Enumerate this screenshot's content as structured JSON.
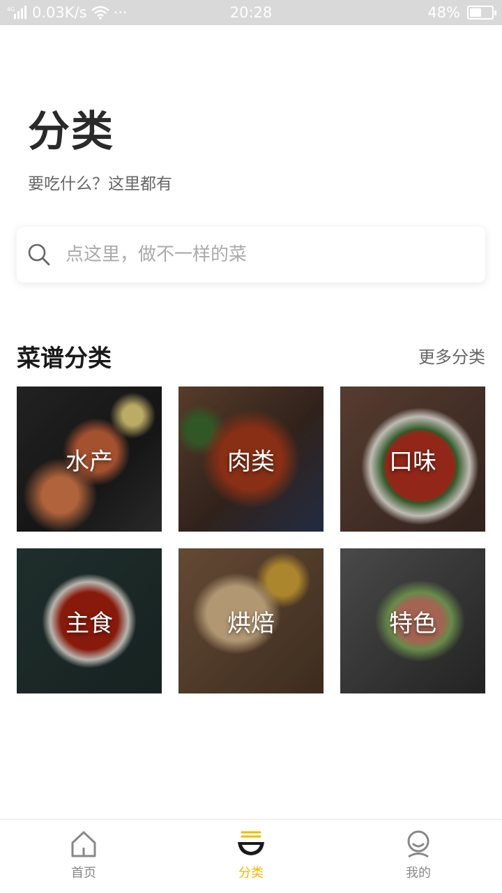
{
  "status_bar": {
    "network_type": "4G",
    "speed": "0.03K/s",
    "more": "···",
    "time": "20:28",
    "battery_percent_text": "48%",
    "battery_level": 0.48,
    "icons": [
      "signal-icon",
      "wifi-icon",
      "battery-icon"
    ]
  },
  "header": {
    "title": "分类",
    "subtitle": "要吃什么？这里都有"
  },
  "search": {
    "placeholder": "点这里，做不一样的菜",
    "icon": "search-icon"
  },
  "section": {
    "title": "菜谱分类",
    "more_label": "更多分类"
  },
  "categories": [
    {
      "label": "水产"
    },
    {
      "label": "肉类"
    },
    {
      "label": "口味"
    },
    {
      "label": "主食"
    },
    {
      "label": "烘焙"
    },
    {
      "label": "特色"
    }
  ],
  "bottom_nav": {
    "items": [
      {
        "label": "首页",
        "icon": "home-icon",
        "active": false
      },
      {
        "label": "分类",
        "icon": "bowl-icon",
        "active": true
      },
      {
        "label": "我的",
        "icon": "profile-icon",
        "active": false
      }
    ],
    "active_color": "#f5b800",
    "inactive_color": "#888888"
  },
  "colors": {
    "accent": "#f5b800",
    "status_bar_bg": "#d9d9d9"
  }
}
